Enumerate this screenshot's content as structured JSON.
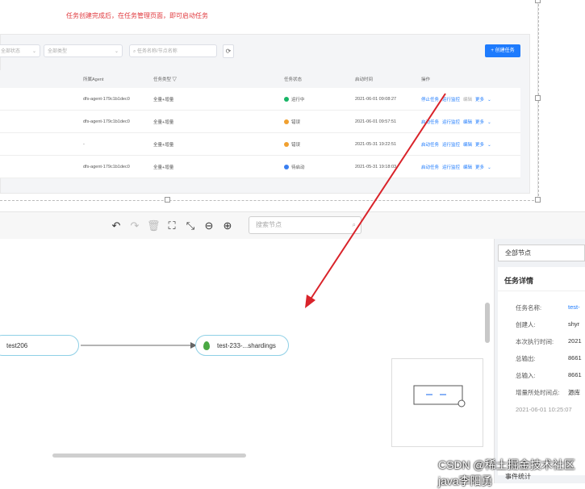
{
  "hint": "任务创建完成后，在任务管理页面，即可启动任务",
  "filters": {
    "status": "全部状态",
    "type": "全部类型",
    "search_placeholder": "任务名称/节点名称"
  },
  "create_button": "+ 创建任务",
  "refresh_icon": "refresh-icon",
  "table": {
    "headers": [
      "所属Agent",
      "任务类型",
      "任务状态",
      "启动时间",
      "操作"
    ],
    "rows": [
      {
        "agent": "dfs-agent-179c1b1dec0",
        "type": "全量+增量",
        "status": "运行中",
        "status_color": "#18b566",
        "time": "2021-06-01 09:08:27",
        "actions": [
          "停止任务",
          "运行监控",
          "编辑",
          "更多"
        ]
      },
      {
        "agent": "dfs-agent-179c1b1dec0",
        "type": "全量+增量",
        "status": "错误",
        "status_color": "#f0a030",
        "time": "2021-06-01 09:57:51",
        "actions": [
          "启动任务",
          "运行监控",
          "编辑",
          "更多"
        ]
      },
      {
        "agent": "-",
        "type": "全量+增量",
        "status": "错误",
        "status_color": "#f0a030",
        "time": "2021-05-31 19:22:51",
        "actions": [
          "启动任务",
          "运行监控",
          "编辑",
          "更多"
        ]
      },
      {
        "agent": "dfs-agent-179c1b1dec0",
        "type": "全量+增量",
        "status": "待启动",
        "status_color": "#3a7ff0",
        "time": "2021-05-31 19:18:03",
        "actions": [
          "启动任务",
          "运行监控",
          "编辑",
          "更多"
        ]
      }
    ]
  },
  "toolbar": {
    "search_placeholder": "搜索节点"
  },
  "nodes": {
    "source": "test206",
    "target": "test-233-...shardings"
  },
  "right_panel": {
    "filter": "全部节点",
    "detail_title": "任务详情",
    "fields": [
      {
        "label": "任务名称:",
        "value": "test-"
      },
      {
        "label": "创建人:",
        "value": "shyr"
      },
      {
        "label": "本次执行时间:",
        "value": "2021"
      },
      {
        "label": "总输出:",
        "value": "8661"
      },
      {
        "label": "总输入:",
        "value": "8661"
      },
      {
        "label": "增量所处时间点:",
        "value": "源库"
      }
    ],
    "timestamp": "2021-06-01 10:25:07",
    "events_label": "事件统计"
  },
  "watermark": "CSDN @稀土掘金技术社区 java李阳勇",
  "accent_color": "#1e7bfd",
  "arrow_color": "#d9232a"
}
